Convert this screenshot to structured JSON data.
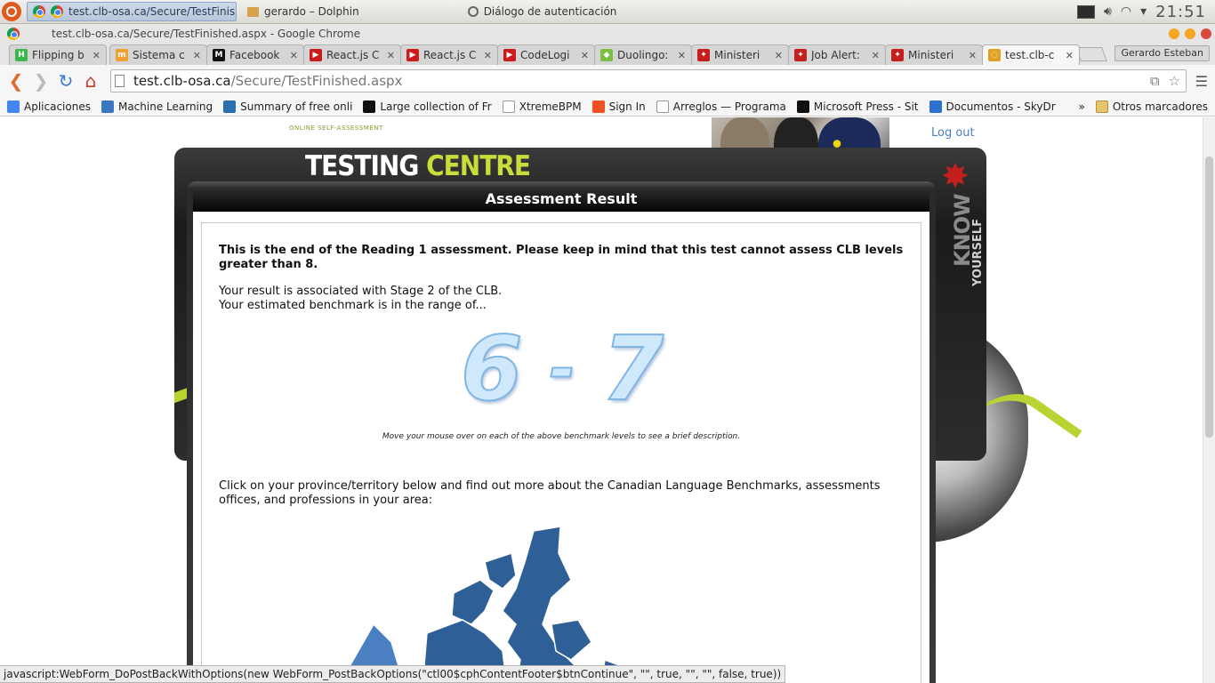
{
  "panel": {
    "active_task": "test.clb-osa.ca/Secure/TestFinished",
    "task_2": "gerardo – Dolphin",
    "task_3": "Diálogo de autenticación",
    "clock": "21:51"
  },
  "window": {
    "title": "test.clb-osa.ca/Secure/TestFinished.aspx - Google Chrome",
    "profile": "Gerardo Esteban"
  },
  "tabs": [
    {
      "label": "Flipping b",
      "color": "#3bb64a",
      "glyph": "H"
    },
    {
      "label": "Sistema c",
      "color": "#f0a030",
      "glyph": "m"
    },
    {
      "label": "Facebook",
      "color": "#111111",
      "glyph": "M"
    },
    {
      "label": "React.js C",
      "color": "#cc1b1b",
      "glyph": "▶"
    },
    {
      "label": "React.js C",
      "color": "#cc1b1b",
      "glyph": "▶"
    },
    {
      "label": "CodeLogi",
      "color": "#cc1b1b",
      "glyph": "▶"
    },
    {
      "label": "Duolingo:",
      "color": "#7ac142",
      "glyph": "◆"
    },
    {
      "label": "Ministeri",
      "color": "#c31f1f",
      "glyph": "✦"
    },
    {
      "label": "Job Alert:",
      "color": "#c31f1f",
      "glyph": "✦"
    },
    {
      "label": "Ministeri",
      "color": "#c31f1f",
      "glyph": "✦"
    },
    {
      "label": "test.clb-c",
      "color": "#e0a020",
      "glyph": "◌"
    }
  ],
  "address": {
    "host": "test.clb-osa.ca",
    "path": "/Secure/TestFinished.aspx"
  },
  "bookmarks": [
    {
      "label": "Aplicaciones",
      "color": "#4285f4"
    },
    {
      "label": "Machine Learning",
      "color": "#3a78c2"
    },
    {
      "label": "Summary of free onli",
      "color": "#2a6fb0"
    },
    {
      "label": "Large collection of Fr",
      "color": "#111111"
    },
    {
      "label": "XtremeBPM",
      "color": "#ffffff"
    },
    {
      "label": "Sign In",
      "color": "#f25022"
    },
    {
      "label": "Arreglos — Programa",
      "color": "#ffffff"
    },
    {
      "label": "Microsoft Press - Sit",
      "color": "#111111"
    },
    {
      "label": "Documentos - SkyDr",
      "color": "#2f6fd0"
    }
  ],
  "bookmarks_more": "»",
  "bookmarks_other": "Otros marcadores",
  "page": {
    "osa_tagline": "ONLINE SELF-ASSESSMENT",
    "logout": "Log out",
    "tc_white": "TESTING",
    "tc_green": "CENTRE",
    "know": "KNOW",
    "yourself": "YOURSELF",
    "panel_title": "Assessment Result",
    "intro": "This is the end of the Reading 1 assessment. Please keep in mind that this test cannot assess CLB levels greater than 8.",
    "result_stage": "Your result is associated with Stage 2 of the CLB.",
    "result_range": "Your estimated benchmark is in the range of...",
    "bench_low": "6",
    "bench_dash": "-",
    "bench_high": "7",
    "hint": "Move your mouse over on each of the above benchmark levels to see a brief description.",
    "province": "Click on your province/territory below and find out more about the Canadian Language Benchmarks, assessments offices, and professions in your area:"
  },
  "status": "javascript:WebForm_DoPostBackWithOptions(new WebForm_PostBackOptions(\"ctl00$cphContentFooter$btnContinue\", \"\", true, \"\", \"\", false, true))"
}
